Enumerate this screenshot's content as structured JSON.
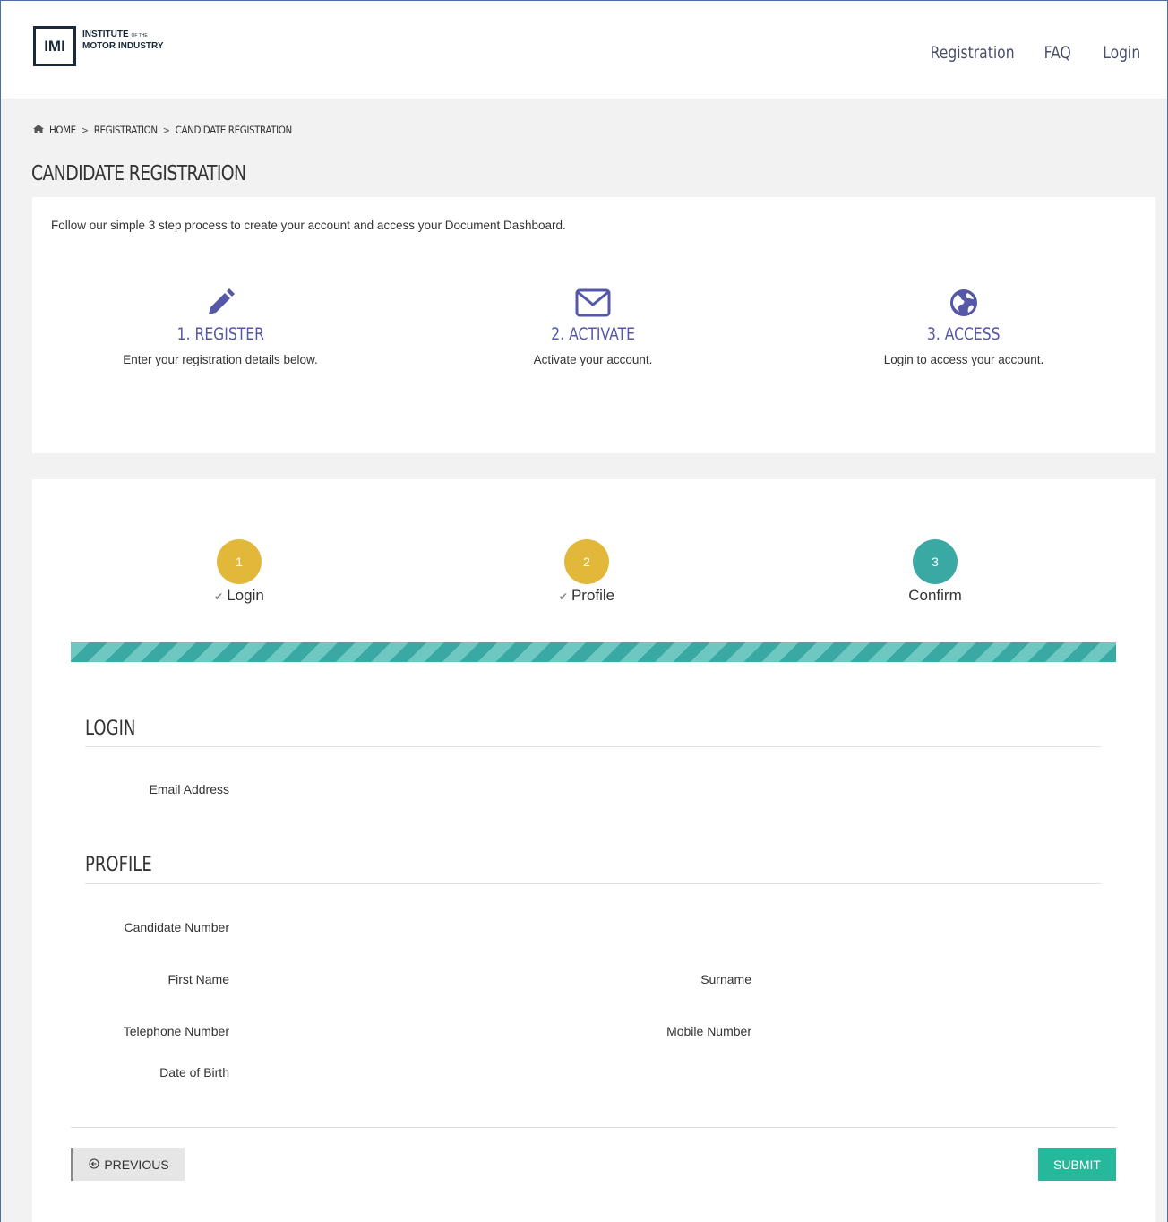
{
  "header": {
    "logo_mark": "IMI",
    "logo_line1": "INSTITUTE",
    "logo_small": "OF THE",
    "logo_line2": "MOTOR INDUSTRY",
    "nav": [
      "Registration",
      "FAQ",
      "Login"
    ]
  },
  "breadcrumb": {
    "items": [
      "HOME",
      "REGISTRATION",
      "CANDIDATE REGISTRATION"
    ],
    "separator": ">"
  },
  "page_title": "CANDIDATE REGISTRATION",
  "intro": {
    "text": "Follow our simple 3 step process to create your account and access your Document Dashboard.",
    "steps": [
      {
        "icon": "pencil-icon",
        "title": "1. REGISTER",
        "desc": "Enter your registration details below."
      },
      {
        "icon": "envelope-icon",
        "title": "2. ACTIVATE",
        "desc": "Activate your account."
      },
      {
        "icon": "globe-icon",
        "title": "3. ACCESS",
        "desc": "Login to access your account."
      }
    ]
  },
  "wizard": {
    "steps": [
      {
        "number": "1",
        "label": "Login",
        "done": true
      },
      {
        "number": "2",
        "label": "Profile",
        "done": true
      },
      {
        "number": "3",
        "label": "Confirm",
        "done": false
      }
    ],
    "colors": {
      "done": "#e2b83a",
      "active": "#3aa9a3"
    }
  },
  "login_section": {
    "title": "LOGIN",
    "fields": [
      "Email Address"
    ]
  },
  "profile_section": {
    "title": "PROFILE",
    "fields": {
      "candidate_number": "Candidate Number",
      "first_name": "First Name",
      "surname": "Surname",
      "telephone": "Telephone Number",
      "mobile": "Mobile Number",
      "dob": "Date of Birth"
    }
  },
  "buttons": {
    "previous": "PREVIOUS",
    "submit": "SUBMIT"
  }
}
